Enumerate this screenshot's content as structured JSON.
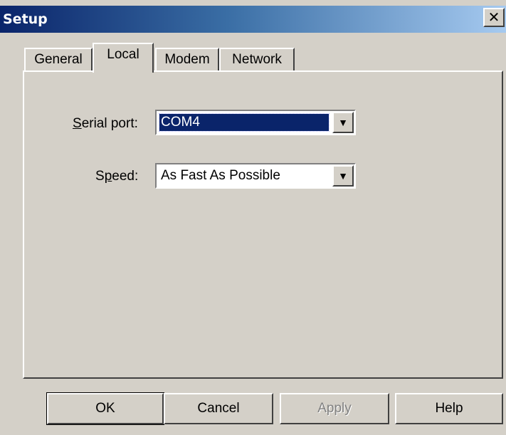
{
  "window": {
    "title": "Setup",
    "close_glyph": "✕"
  },
  "tabs": [
    {
      "label": "General",
      "active": false
    },
    {
      "label": "Local",
      "active": true
    },
    {
      "label": "Modem",
      "active": false
    },
    {
      "label": "Network",
      "active": false
    }
  ],
  "local": {
    "serial_port": {
      "label_mnemonic": "S",
      "label_rest": "erial port:",
      "value": "COM4"
    },
    "speed": {
      "label_pre": "S",
      "label_mnemonic": "p",
      "label_rest": "eed:",
      "value": "As Fast As Possible"
    },
    "dropdown_glyph": "▼"
  },
  "buttons": {
    "ok": "OK",
    "cancel": "Cancel",
    "apply": "Apply",
    "help": "Help"
  }
}
